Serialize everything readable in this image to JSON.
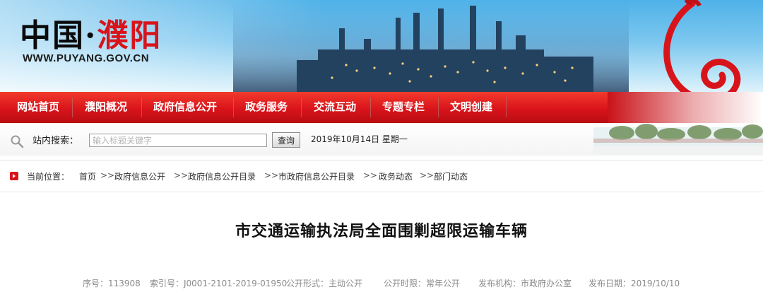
{
  "site": {
    "logo_text_a": "中国",
    "logo_dot": "·",
    "logo_text_b": "濮阳",
    "url": "WWW.PUYANG.GOV.CN"
  },
  "nav": {
    "items": [
      {
        "label": "网站首页"
      },
      {
        "label": "濮阳概况"
      },
      {
        "label": "政府信息公开"
      },
      {
        "label": "政务服务"
      },
      {
        "label": "交流互动"
      },
      {
        "label": "专题专栏"
      },
      {
        "label": "文明创建"
      }
    ]
  },
  "search": {
    "label": "站内搜索：",
    "placeholder": "输入标题关键字",
    "button": "查询",
    "date": "2019年10月14日  星期一"
  },
  "breadcrumb": {
    "prefix": "当前位置：",
    "items": [
      "首页",
      "政府信息公开",
      "政府信息公开目录",
      "市政府信息公开目录",
      "政务动态",
      "部门动态"
    ],
    "separator": ">>"
  },
  "article": {
    "title": "市交通运输执法局全面围剿超限运输车辆",
    "meta": {
      "serial": "序号：113908",
      "index": "索引号：J0001-2101-2019-01950",
      "form": "公开形式：主动公开",
      "period": "公开时限：常年公开",
      "publisher": "发布机构：市政府办公室",
      "date": "发布日期：2019/10/10"
    }
  },
  "colors": {
    "nav_red": "#d9141b",
    "sky_blue": "#4fb2e8",
    "meta_gray": "#8a8a8a"
  },
  "icons": [
    "search-icon",
    "breadcrumb-arrow-icon"
  ]
}
